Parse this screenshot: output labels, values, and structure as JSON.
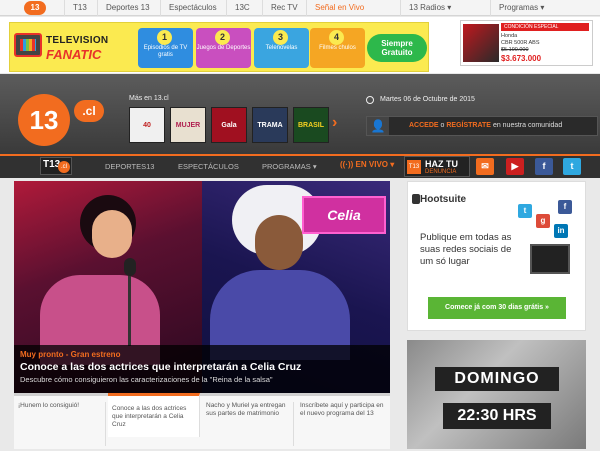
{
  "topnav": {
    "logo": "13",
    "items": [
      {
        "label": "T13"
      },
      {
        "label": "Deportes 13"
      },
      {
        "label": "Espectáculos"
      },
      {
        "label": "13C"
      },
      {
        "label": "Rec TV"
      },
      {
        "label": "Señal en Vivo"
      },
      {
        "label": "13 Radios ▾"
      },
      {
        "label": "Programas ▾"
      }
    ]
  },
  "ad_tvfanatic": {
    "brand_line1": "TELEVISION",
    "brand_line2": "FANATIC",
    "steps": [
      {
        "num": "1",
        "text": "Episodios de TV gratis",
        "color": "#2f8de0"
      },
      {
        "num": "2",
        "text": "Juegos de Deportes",
        "color": "#c94fbf"
      },
      {
        "num": "3",
        "text": "Telenovelas",
        "color": "#3aa5e0"
      },
      {
        "num": "4",
        "text": "Filmes chulos",
        "color": "#f5a623"
      }
    ],
    "button": "Siempre Gratuito"
  },
  "ad_moto": {
    "header": "CONDICIÓN ESPECIAL",
    "line1": "Honda",
    "line2": "CBR 500R ABS",
    "price_old": "$5.190.000",
    "price": "$3.673.000"
  },
  "header": {
    "logo_num": "13",
    "logo_cl": ".cl",
    "mas_label": "Más en 13.cl",
    "thumbs": [
      {
        "label": "40",
        "bg": "#f0f0f0",
        "fg": "#c02020"
      },
      {
        "label": "MUJER",
        "bg": "#e8e0d0",
        "fg": "#b02050"
      },
      {
        "label": "Gala",
        "bg": "#a01020",
        "fg": "#ffffff"
      },
      {
        "label": "TRAMA",
        "bg": "#2a3a5a",
        "fg": "#ffffff"
      },
      {
        "label": "BRASIL",
        "bg": "#1a4a20",
        "fg": "#f5d020"
      }
    ],
    "date": "Martes 06 de Octubre de 2015",
    "login_accede": "ACCEDE",
    "login_o": "o",
    "login_registrate": "REGÍSTRATE",
    "login_rest": "en nuestra comunidad"
  },
  "mainnav": {
    "badge_a": "T13",
    "badge_b": ".cl",
    "items": [
      {
        "label": "DEPORTES13"
      },
      {
        "label": "ESPECTÁCULOS"
      },
      {
        "label": "PROGRAMAS ▾"
      }
    ],
    "envivo": "((·)) EN VIVO ▾",
    "haztu_a": "HAZ TU",
    "haztu_b": "DENUNCIA",
    "haztu_icon": "T13",
    "social": [
      {
        "name": "mail-icon",
        "glyph": "✉",
        "color": "#f26c1f"
      },
      {
        "name": "youtube-icon",
        "glyph": "▶",
        "color": "#cc2020"
      },
      {
        "name": "facebook-icon",
        "glyph": "f",
        "color": "#3b5998"
      },
      {
        "name": "twitter-icon",
        "glyph": "t",
        "color": "#2fa8e0"
      }
    ]
  },
  "hero": {
    "celia": "Celia",
    "kicker": "Muy pronto - Gran estreno",
    "title": "Conoce a las dos actrices que interpretarán a Celia Cruz",
    "subtitle": "Descubre cómo consiguieron las caracterizaciones de la \"Reina de la salsa\""
  },
  "subtabs": [
    {
      "text": "¡Hunem lo consiguió!"
    },
    {
      "text": "Conoce a las dos actrices que interpretarán a Celia Cruz"
    },
    {
      "text": "Nacho y Muriel ya entregan sus partes de matrimonio"
    },
    {
      "text": "Inscríbete aquí y participa en el nuevo programa del 13"
    }
  ],
  "hootsuite": {
    "logo": "Hootsuite",
    "text": "Publique em todas as suas redes sociais de um só lugar",
    "cta": "Comece já com 30 dias grátis »"
  },
  "domingo": {
    "line1": "DOMINGO",
    "line2": "22:30 HRS"
  }
}
